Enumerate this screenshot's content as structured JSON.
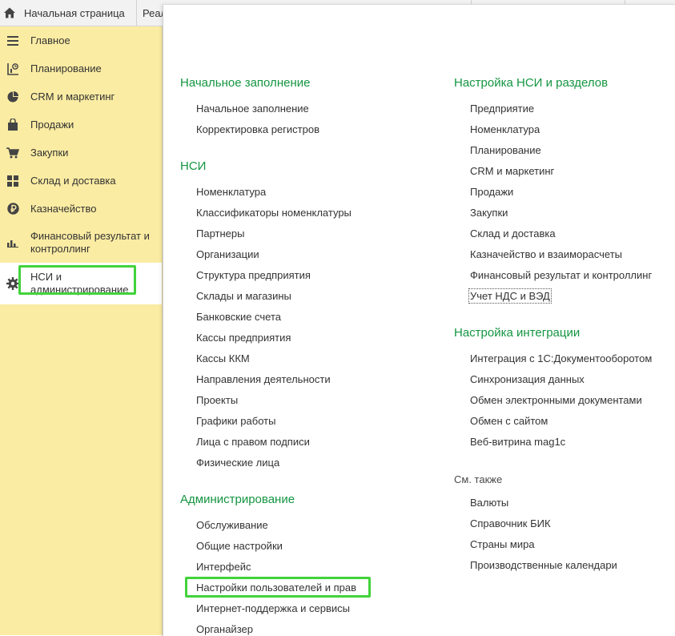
{
  "tabs": [
    {
      "label": "Начальная страница",
      "icon": "home-icon"
    },
    {
      "label": "Реализация"
    }
  ],
  "sidebar": {
    "items": [
      {
        "label": "Главное",
        "icon": "menu-lines-icon"
      },
      {
        "label": "Планирование",
        "icon": "planning-icon"
      },
      {
        "label": "CRM и маркетинг",
        "icon": "pie-chart-icon"
      },
      {
        "label": "Продажи",
        "icon": "shopping-bag-icon"
      },
      {
        "label": "Закупки",
        "icon": "cart-icon"
      },
      {
        "label": "Склад и доставка",
        "icon": "warehouse-grid-icon"
      },
      {
        "label": "Казначейство",
        "icon": "ruble-icon"
      },
      {
        "label": "Финансовый результат и контроллинг",
        "icon": "bar-chart-icon"
      },
      {
        "label": "НСИ и администрирование",
        "icon": "gear-icon",
        "active": true
      }
    ]
  },
  "sections": {
    "initial": {
      "title": "Начальное заполнение",
      "items": [
        "Начальное заполнение",
        "Корректировка регистров"
      ]
    },
    "nsi": {
      "title": "НСИ",
      "items": [
        "Номенклатура",
        "Классификаторы номенклатуры",
        "Партнеры",
        "Организации",
        "Структура предприятия",
        "Склады и магазины",
        "Банковские счета",
        "Кассы предприятия",
        "Кассы ККМ",
        "Направления деятельности",
        "Проекты",
        "Графики работы",
        "Лица с правом подписи",
        "Физические лица"
      ]
    },
    "admin": {
      "title": "Администрирование",
      "items": [
        "Обслуживание",
        "Общие настройки",
        "Интерфейс",
        "Настройки пользователей и прав",
        "Интернет-поддержка и сервисы",
        "Органайзер"
      ]
    },
    "nsi_settings": {
      "title": "Настройка НСИ и разделов",
      "items": [
        "Предприятие",
        "Номенклатура",
        "Планирование",
        "CRM и маркетинг",
        "Продажи",
        "Закупки",
        "Склад и доставка",
        "Казначейство и взаиморасчеты",
        "Финансовый результат и контроллинг",
        "Учет НДС и ВЭД"
      ]
    },
    "integration": {
      "title": "Настройка интеграции",
      "items": [
        "Интеграция с 1С:Документооборотом",
        "Синхронизация данных",
        "Обмен электронными документами",
        "Обмен с сайтом",
        "Веб-витрина mag1c"
      ]
    },
    "see_also": {
      "title": "См. также",
      "items": [
        "Валюты",
        "Справочник БИК",
        "Страны мира",
        "Производственные календари"
      ]
    }
  },
  "colors": {
    "sidebar_bg": "#fbeca3",
    "section_title": "#149541",
    "highlight": "#42d33b"
  }
}
